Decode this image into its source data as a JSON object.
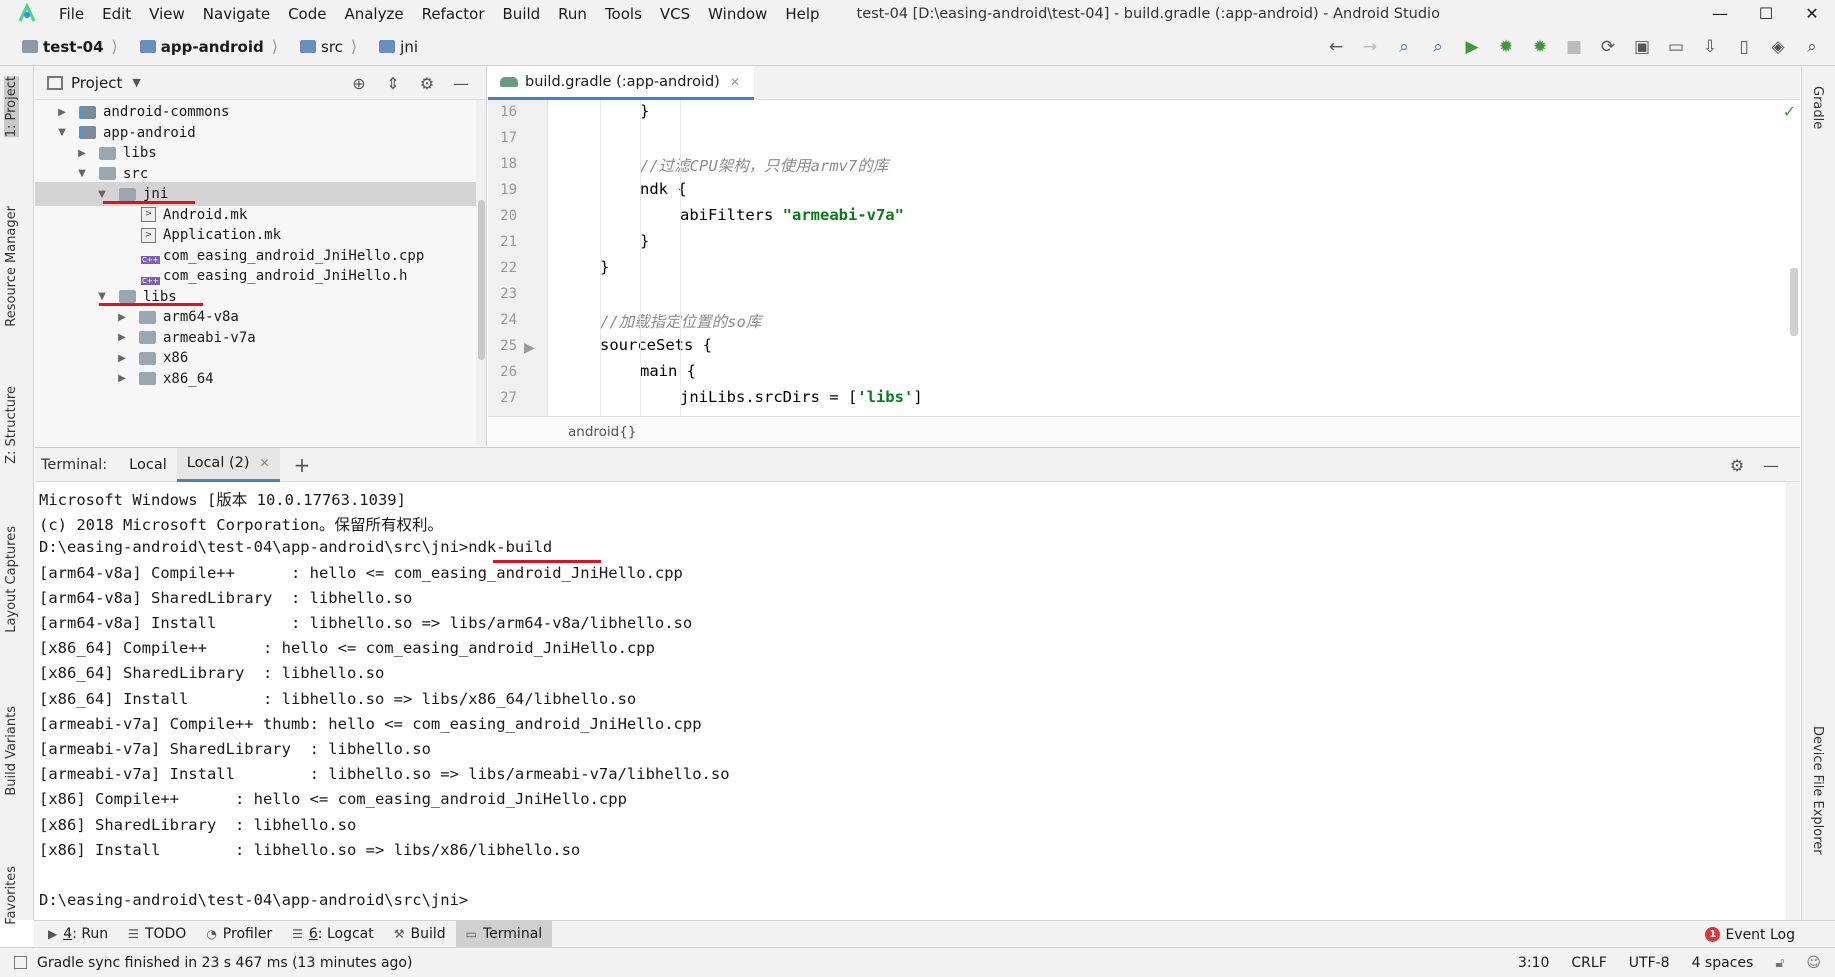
{
  "window": {
    "title": "test-04 [D:\\easing-android\\test-04] - build.gradle (:app-android) - Android Studio",
    "menu": [
      "File",
      "Edit",
      "View",
      "Navigate",
      "Code",
      "Analyze",
      "Refactor",
      "Build",
      "Run",
      "Tools",
      "VCS",
      "Window",
      "Help"
    ],
    "controls": {
      "minimize": "—",
      "maximize": "☐",
      "close": "✕"
    }
  },
  "breadcrumb": [
    "test-04",
    "app-android",
    "src",
    "jni"
  ],
  "left_strip": [
    "1: Project",
    "Resource Manager",
    "Z: Structure",
    "Layout Captures",
    "Build Variants",
    "Favorites"
  ],
  "right_strip": [
    "Gradle",
    "Device File Explorer"
  ],
  "project": {
    "title": "Project",
    "tree": [
      {
        "label": "android-commons",
        "depth": 0,
        "expanded": false,
        "kind": "module"
      },
      {
        "label": "app-android",
        "depth": 0,
        "expanded": true,
        "kind": "module"
      },
      {
        "label": "libs",
        "depth": 1,
        "expanded": false,
        "kind": "folder"
      },
      {
        "label": "src",
        "depth": 1,
        "expanded": true,
        "kind": "folder"
      },
      {
        "label": "jni",
        "depth": 2,
        "expanded": true,
        "kind": "folder",
        "selected": true
      },
      {
        "label": "Android.mk",
        "depth": 3,
        "kind": "mk"
      },
      {
        "label": "Application.mk",
        "depth": 3,
        "kind": "mk"
      },
      {
        "label": "com_easing_android_JniHello.cpp",
        "depth": 3,
        "kind": "cpp"
      },
      {
        "label": "com_easing_android_JniHello.h",
        "depth": 3,
        "kind": "cpp"
      },
      {
        "label": "libs",
        "depth": 2,
        "expanded": true,
        "kind": "folder"
      },
      {
        "label": "arm64-v8a",
        "depth": 3,
        "expanded": false,
        "kind": "folder"
      },
      {
        "label": "armeabi-v7a",
        "depth": 3,
        "expanded": false,
        "kind": "folder"
      },
      {
        "label": "x86",
        "depth": 3,
        "expanded": false,
        "kind": "folder"
      },
      {
        "label": "x86_64",
        "depth": 3,
        "expanded": false,
        "kind": "folder"
      }
    ]
  },
  "editor": {
    "tab": "build.gradle (:app-android)",
    "breadcrumb": "android{}",
    "lines": [
      {
        "n": "16",
        "indent": 2,
        "parts": [
          {
            "t": "}",
            "c": "kw"
          }
        ]
      },
      {
        "n": "17",
        "indent": 0,
        "parts": []
      },
      {
        "n": "18",
        "indent": 2,
        "parts": [
          {
            "t": "//过滤CPU架构，只使用armv7的库",
            "c": "cm"
          }
        ]
      },
      {
        "n": "19",
        "indent": 2,
        "parts": [
          {
            "t": "ndk {",
            "c": "kw"
          }
        ]
      },
      {
        "n": "20",
        "indent": 3,
        "parts": [
          {
            "t": "abiFilters ",
            "c": "kw"
          },
          {
            "t": "\"armeabi-v7a\"",
            "c": "str"
          }
        ]
      },
      {
        "n": "21",
        "indent": 2,
        "parts": [
          {
            "t": "}",
            "c": "kw"
          }
        ]
      },
      {
        "n": "22",
        "indent": 1,
        "parts": [
          {
            "t": "}",
            "c": "kw"
          }
        ]
      },
      {
        "n": "23",
        "indent": 0,
        "parts": []
      },
      {
        "n": "24",
        "indent": 1,
        "parts": [
          {
            "t": "//加载指定位置的so库",
            "c": "cm"
          }
        ]
      },
      {
        "n": "25",
        "indent": 1,
        "parts": [
          {
            "t": "sourceSets {",
            "c": "kw"
          }
        ]
      },
      {
        "n": "26",
        "indent": 2,
        "parts": [
          {
            "t": "main {",
            "c": "kw"
          }
        ]
      },
      {
        "n": "27",
        "indent": 3,
        "parts": [
          {
            "t": "jniLibs.srcDirs = [",
            "c": "kw"
          },
          {
            "t": "'libs'",
            "c": "str"
          },
          {
            "t": "]",
            "c": "kw"
          }
        ]
      }
    ]
  },
  "terminal": {
    "label": "Terminal:",
    "tabs": [
      "Local",
      "Local (2)"
    ],
    "active_tab": 1,
    "lines": [
      "Microsoft Windows [版本 10.0.17763.1039]",
      "(c) 2018 Microsoft Corporation。保留所有权利。",
      "D:\\easing-android\\test-04\\app-android\\src\\jni>ndk-build",
      "[arm64-v8a] Compile++      : hello <= com_easing_android_JniHello.cpp",
      "[arm64-v8a] SharedLibrary  : libhello.so",
      "[arm64-v8a] Install        : libhello.so => libs/arm64-v8a/libhello.so",
      "[x86_64] Compile++      : hello <= com_easing_android_JniHello.cpp",
      "[x86_64] SharedLibrary  : libhello.so",
      "[x86_64] Install        : libhello.so => libs/x86_64/libhello.so",
      "[armeabi-v7a] Compile++ thumb: hello <= com_easing_android_JniHello.cpp",
      "[armeabi-v7a] SharedLibrary  : libhello.so",
      "[armeabi-v7a] Install        : libhello.so => libs/armeabi-v7a/libhello.so",
      "[x86] Compile++      : hello <= com_easing_android_JniHello.cpp",
      "[x86] SharedLibrary  : libhello.so",
      "[x86] Install        : libhello.so => libs/x86/libhello.so",
      "",
      "D:\\easing-android\\test-04\\app-android\\src\\jni>"
    ]
  },
  "bottom_tools": [
    {
      "key": "4",
      "label": ": Run",
      "icon": "play-icon"
    },
    {
      "key": "",
      "label": "TODO",
      "icon": "list-icon"
    },
    {
      "key": "",
      "label": "Profiler",
      "icon": "gauge-icon"
    },
    {
      "key": "6",
      "label": ": Logcat",
      "icon": "logcat-icon"
    },
    {
      "key": "",
      "label": "Build",
      "icon": "hammer-icon"
    },
    {
      "key": "",
      "label": "Terminal",
      "icon": "terminal-icon",
      "active": true
    }
  ],
  "event_log": {
    "label": "Event Log",
    "count": "1"
  },
  "status": {
    "message": "Gradle sync finished in 23 s 467 ms (13 minutes ago)",
    "position": "3:10",
    "line_sep": "CRLF",
    "encoding": "UTF-8",
    "indent": "4 spaces"
  },
  "colors": {
    "accent": "#4083c9",
    "annotation_red": "#e0101e",
    "string_green": "#067d17",
    "comment_gray": "#8c8c8c"
  }
}
